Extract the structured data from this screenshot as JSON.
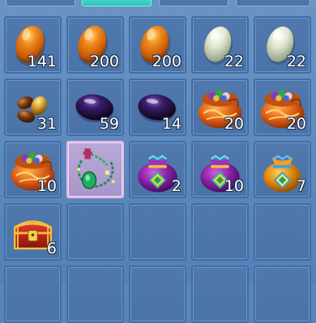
{
  "tabs": [
    {
      "name": "tab-1",
      "active": false
    },
    {
      "name": "tab-2",
      "active": true
    },
    {
      "name": "tab-3",
      "active": false
    },
    {
      "name": "tab-4",
      "active": false
    }
  ],
  "inventory": {
    "rows": [
      [
        {
          "item": "orange-egg",
          "qty": "141"
        },
        {
          "item": "orange-egg",
          "qty": "200"
        },
        {
          "item": "orange-egg",
          "qty": "200"
        },
        {
          "item": "white-egg",
          "qty": "22"
        },
        {
          "item": "white-egg",
          "qty": "22"
        }
      ],
      [
        {
          "item": "beans",
          "qty": "31"
        },
        {
          "item": "dark-stone",
          "qty": "59"
        },
        {
          "item": "dark-stone",
          "qty": "14"
        },
        {
          "item": "orange-gem-pouch",
          "qty": "20"
        },
        {
          "item": "orange-gem-pouch",
          "qty": "20"
        }
      ],
      [
        {
          "item": "orange-gem-pouch",
          "qty": "10"
        },
        {
          "item": "jade-necklace",
          "qty": "",
          "selected": true
        },
        {
          "item": "purple-pouch",
          "qty": "2"
        },
        {
          "item": "purple-pouch",
          "qty": "10"
        },
        {
          "item": "gold-pouch",
          "qty": "7"
        }
      ],
      [
        {
          "item": "red-treasure-chest",
          "qty": "6"
        },
        {
          "item": "empty",
          "qty": ""
        },
        {
          "item": "empty",
          "qty": ""
        },
        {
          "item": "empty",
          "qty": ""
        },
        {
          "item": "empty",
          "qty": ""
        }
      ],
      [
        {
          "item": "empty",
          "qty": ""
        },
        {
          "item": "empty",
          "qty": ""
        },
        {
          "item": "empty",
          "qty": ""
        },
        {
          "item": "empty",
          "qty": ""
        },
        {
          "item": "empty",
          "qty": ""
        }
      ]
    ]
  }
}
